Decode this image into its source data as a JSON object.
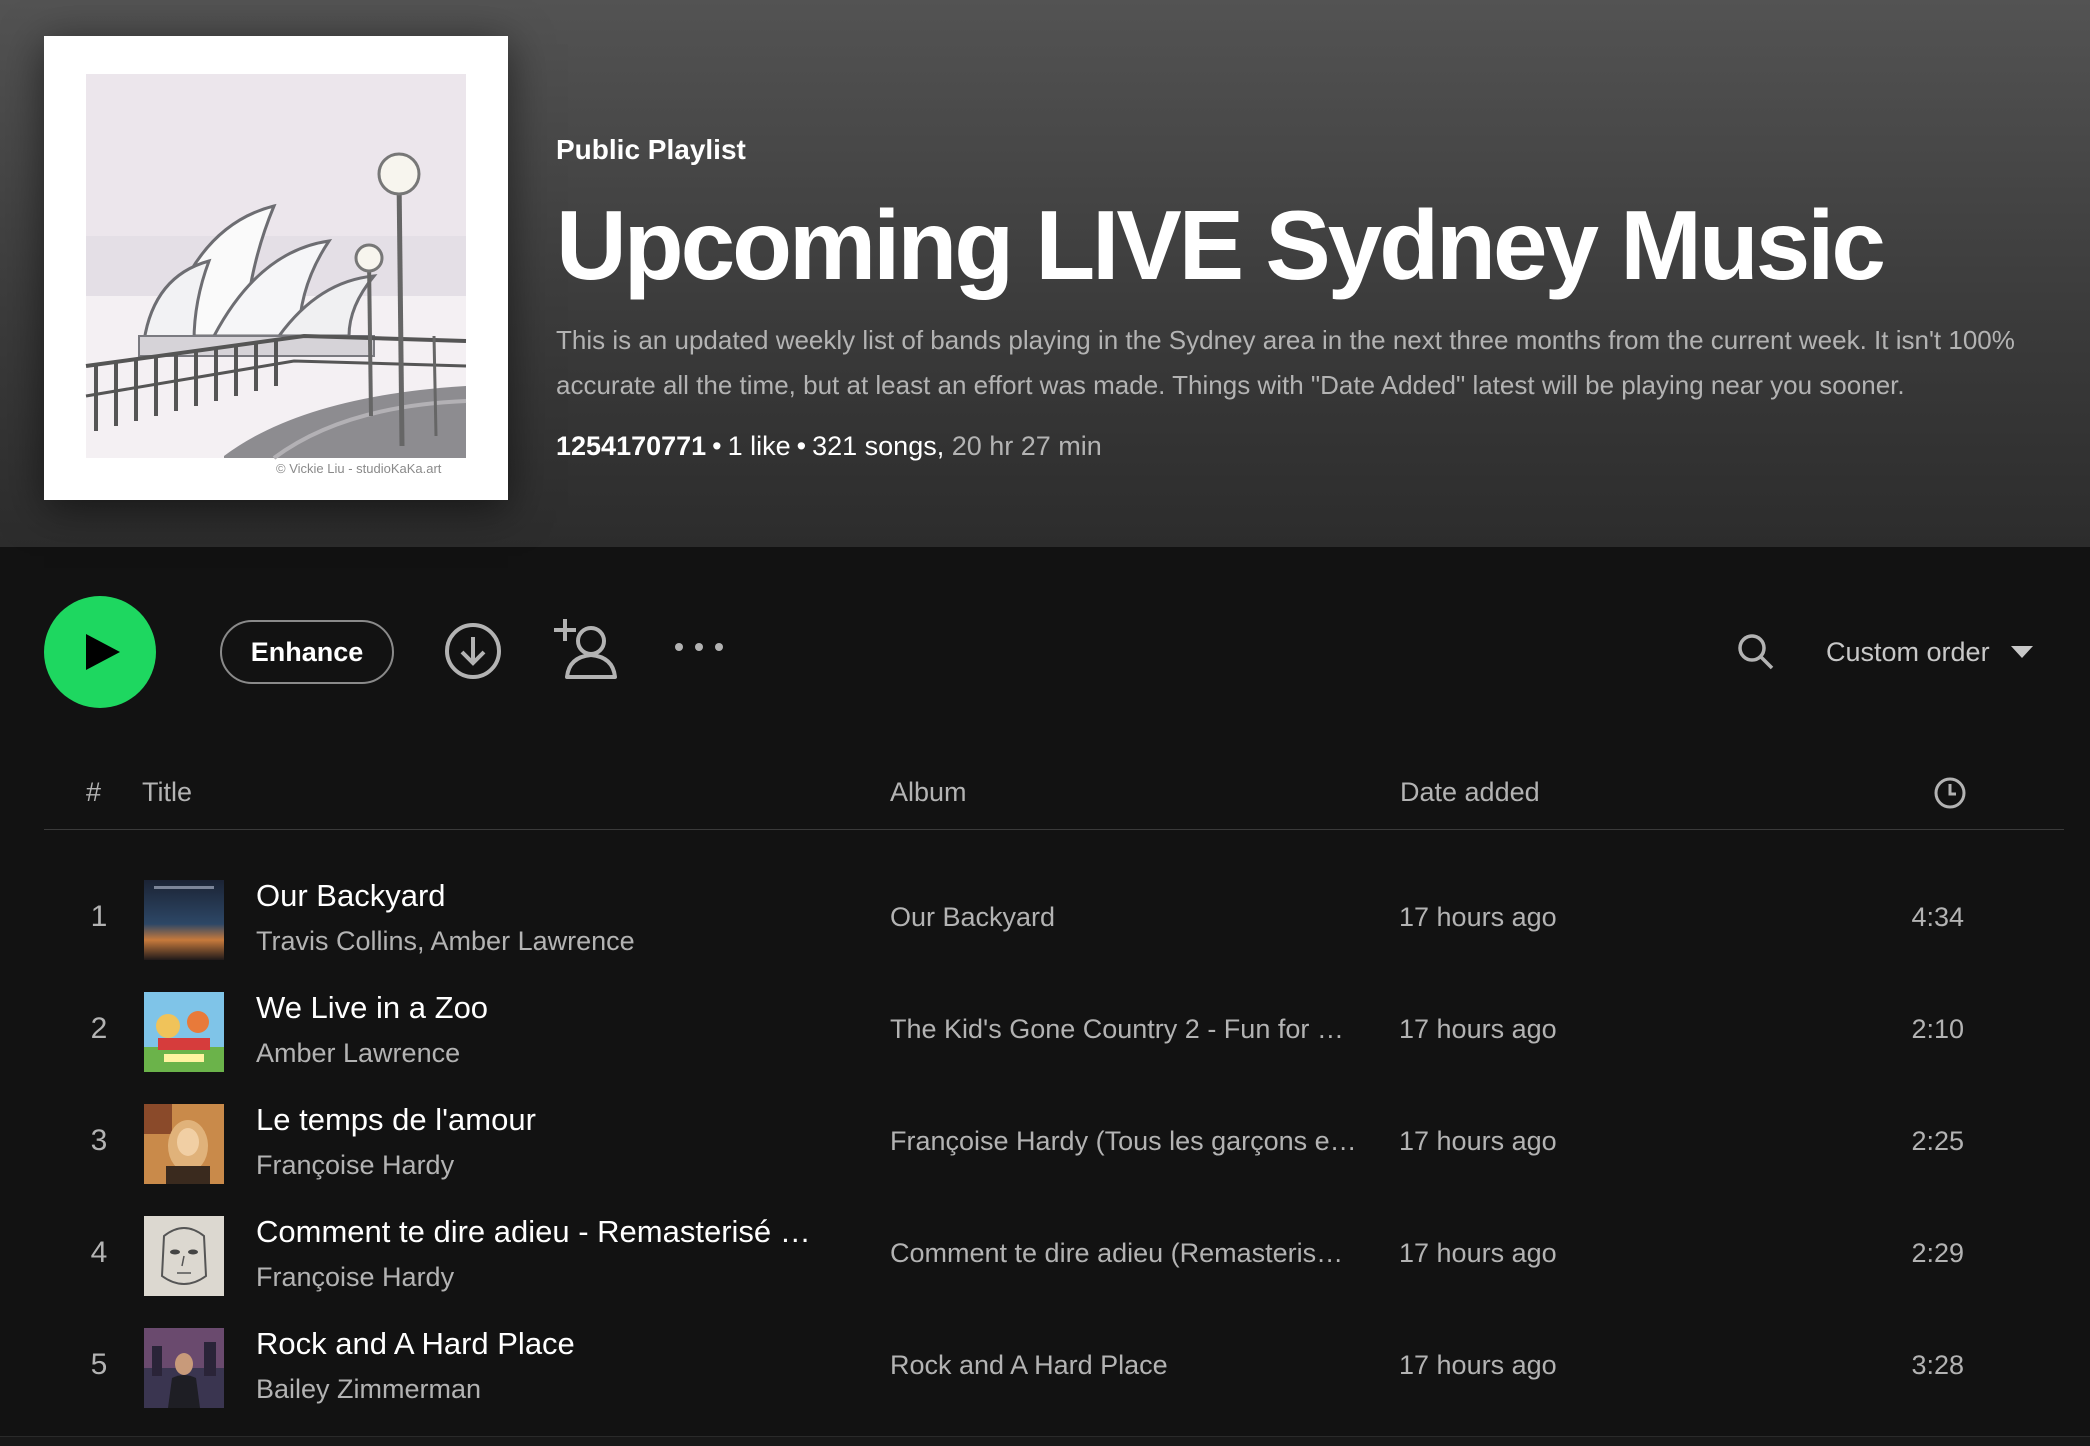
{
  "header": {
    "type_label": "Public Playlist",
    "title": "Upcoming LIVE Sydney Music",
    "description": "This is an updated weekly list of bands playing in the Sydney area in the next three months from the current week. It isn't 100% accurate all the time, but at least an effort was made. Things with \"Date Added\" latest will be playing near you sooner.",
    "owner": "1254170771",
    "likes": "1 like",
    "songs": "321 songs,",
    "duration": "20 hr 27 min",
    "cover_credit": "© Vickie Liu - studioKaKa.art"
  },
  "actions": {
    "enhance_label": "Enhance",
    "sort_label": "Custom order"
  },
  "table": {
    "headers": {
      "number": "#",
      "title": "Title",
      "album": "Album",
      "date_added": "Date added"
    },
    "rows": [
      {
        "num": "1",
        "title": "Our Backyard",
        "artist": "Travis Collins, Amber Lawrence",
        "album": "Our Backyard",
        "date": "17 hours ago",
        "duration": "4:34"
      },
      {
        "num": "2",
        "title": "We Live in a Zoo",
        "artist": "Amber Lawrence",
        "album": "The Kid's Gone Country 2 - Fun for …",
        "date": "17 hours ago",
        "duration": "2:10"
      },
      {
        "num": "3",
        "title": "Le temps de l'amour",
        "artist": "Françoise Hardy",
        "album": "Françoise Hardy (Tous les garçons e…",
        "date": "17 hours ago",
        "duration": "2:25"
      },
      {
        "num": "4",
        "title": "Comment te dire adieu - Remasterisé …",
        "artist": "Françoise Hardy",
        "album": "Comment te dire adieu (Remasteris…",
        "date": "17 hours ago",
        "duration": "2:29"
      },
      {
        "num": "5",
        "title": "Rock and A Hard Place",
        "artist": "Bailey Zimmerman",
        "album": "Rock and A Hard Place",
        "date": "17 hours ago",
        "duration": "3:28"
      }
    ]
  },
  "colors": {
    "accent": "#1ed760",
    "background": "#121212",
    "text_muted": "#b3b3b3"
  },
  "icons": [
    "play-icon",
    "download-icon",
    "add-user-icon",
    "more-options-icon",
    "search-icon",
    "caret-down-icon",
    "clock-icon"
  ]
}
